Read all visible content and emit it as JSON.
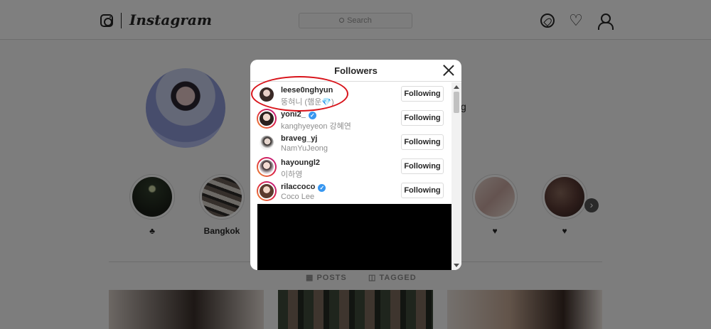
{
  "topbar": {
    "wordmark": "Instagram",
    "search_placeholder": "Search",
    "icons": [
      "instagram-logo-icon",
      "compass-icon",
      "heart-icon",
      "user-icon"
    ]
  },
  "profile": {
    "side_text": "g"
  },
  "highlights": [
    {
      "label": "♣",
      "color": "#2e3b2a"
    },
    {
      "label": "Bangkok",
      "color": "#6b5f56"
    },
    {
      "label": "♥",
      "color": "#c9a7a0"
    },
    {
      "label": "♥",
      "color": "#5a3a34"
    }
  ],
  "tabs": {
    "posts": "POSTS",
    "tagged": "TAGGED"
  },
  "modal": {
    "title": "Followers",
    "followers": [
      {
        "username": "leese0nghyun",
        "fullname": "뚱혀니 (햄운💎)",
        "verified": false,
        "button": "Following"
      },
      {
        "username": "yoni2_",
        "fullname": "kanghyeyeon 강혜연",
        "verified": true,
        "button": "Following"
      },
      {
        "username": "braveg_yj",
        "fullname": "NamYuJeong",
        "verified": false,
        "button": "Following"
      },
      {
        "username": "hayoungl2",
        "fullname": "이하영",
        "verified": false,
        "button": "Following"
      },
      {
        "username": "rilaccoco",
        "fullname": "Coco Lee",
        "verified": true,
        "button": "Following"
      }
    ]
  },
  "colors": {
    "annotation": "#d8131a",
    "verified": "#3897f0",
    "overlay": "rgba(0,0,0,0.5)"
  }
}
